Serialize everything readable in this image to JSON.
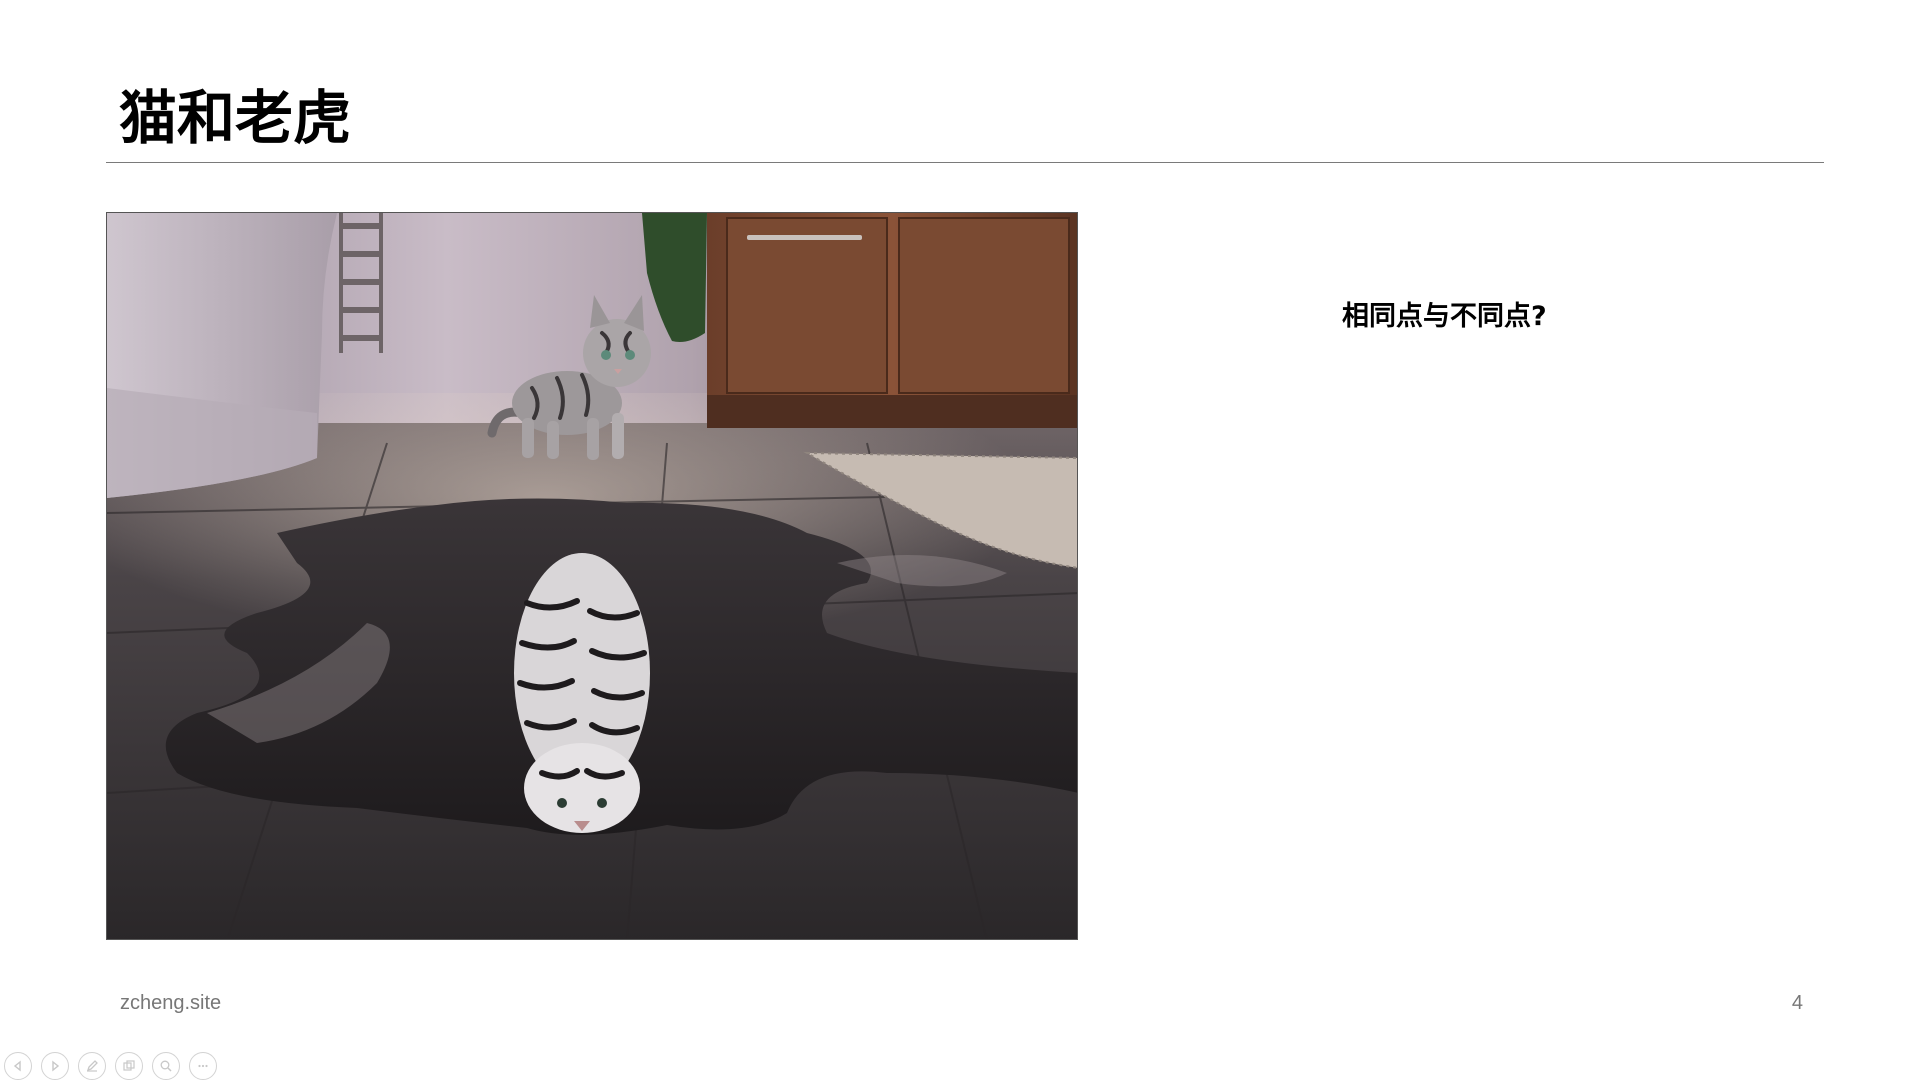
{
  "slide": {
    "title": "猫和老虎",
    "question": "相同点与不同点?",
    "footer_site": "zcheng.site",
    "page_number": "4"
  },
  "toolbar": {
    "buttons": [
      {
        "icon": "previous-icon"
      },
      {
        "icon": "next-icon"
      },
      {
        "icon": "pen-icon"
      },
      {
        "icon": "slides-icon"
      },
      {
        "icon": "zoom-icon"
      },
      {
        "icon": "more-icon"
      }
    ]
  },
  "colors": {
    "title": "#000000",
    "rule": "#7a7a7a",
    "footer": "#777777",
    "toolbar_icon": "#c8c8c8"
  }
}
